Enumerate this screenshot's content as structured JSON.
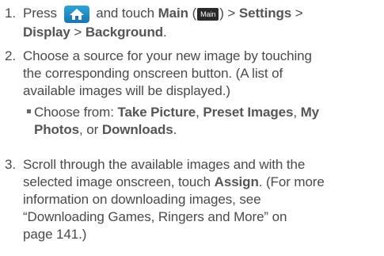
{
  "steps": [
    {
      "number": "1.",
      "text_press": "Press",
      "icon_home": "home-icon",
      "text_and_touch": "and touch",
      "main_label": "Main",
      "open_paren": "(",
      "main_badge": "Main",
      "close_paren_gt": ") >",
      "settings_label": "Settings",
      "gt1": " >",
      "display_label": "Display",
      "gt2": " > ",
      "background_label": "Background",
      "period": "."
    },
    {
      "number": "2.",
      "line1": "Choose a source for your new image by touching",
      "line2": "the corresponding onscreen button. (A list of",
      "line3": "available images will be displayed.)"
    },
    {
      "bullet_intro": "Choose from: ",
      "opt1": "Take Picture",
      "sep1": ", ",
      "opt2": "Preset Images",
      "sep2": ", ",
      "opt3_line1": "My",
      "opt3_line2": "Photos",
      "sep3": ", or ",
      "opt4": "Downloads",
      "end": "."
    },
    {
      "number": "3.",
      "line1": "Scroll through the available images and with the",
      "line2_pre": "selected image onscreen, touch ",
      "assign_label": "Assign",
      "line2_post": ". (For more",
      "line3": "information on downloading images, see",
      "line4": "“Downloading Games, Ringers and More” on",
      "line5": "page 141.)"
    }
  ],
  "colors": {
    "text": "#4a4a4a",
    "icon_blue": "#1f8ac4"
  }
}
